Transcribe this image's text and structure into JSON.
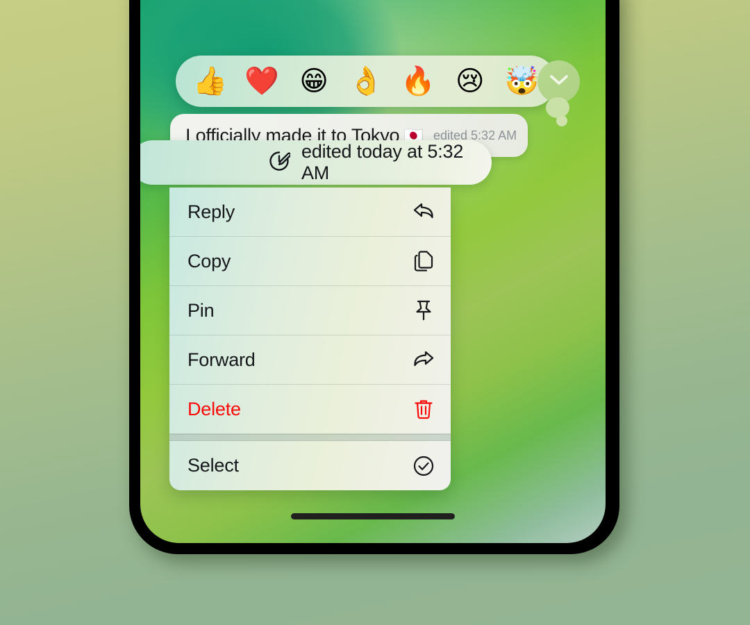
{
  "device": {
    "home_indicator": "home-indicator",
    "bezel_color": "#000000"
  },
  "wallpaper": {
    "gradient_from": "#0d9e6c",
    "gradient_mid": "#93c93d",
    "gradient_to": "#b3cdc2",
    "page_background_from": "#c6cd85",
    "page_background_to": "#94b593"
  },
  "reaction_bar": {
    "name": "emoji-reaction-bar",
    "emojis": [
      {
        "name": "thumbs-up-reaction",
        "glyph": "👍"
      },
      {
        "name": "heart-reaction",
        "glyph": "❤️"
      },
      {
        "name": "grinning-face-reaction",
        "glyph": "😁"
      },
      {
        "name": "ok-hand-reaction",
        "glyph": "👌"
      },
      {
        "name": "fire-reaction",
        "glyph": "🔥"
      },
      {
        "name": "crying-face-reaction",
        "glyph": "😢"
      },
      {
        "name": "exploding-head-reaction",
        "glyph": "🤯"
      }
    ],
    "more_button": {
      "name": "chevron-down-icon",
      "label": "⌄"
    }
  },
  "message": {
    "text": "I officially made it to Tokyo",
    "flag": "🇯🇵",
    "edited_inline": "edited 5:32 AM"
  },
  "edited_tooltip": {
    "icon": "clock-edit-icon",
    "text": "edited today at 5:32 AM"
  },
  "context_menu": {
    "items": [
      {
        "label": "Reply",
        "icon": "reply-arrow-icon",
        "destructive": false
      },
      {
        "label": "Copy",
        "icon": "copy-documents-icon",
        "destructive": false
      },
      {
        "label": "Pin",
        "icon": "pushpin-icon",
        "destructive": false
      },
      {
        "label": "Forward",
        "icon": "forward-arrow-icon",
        "destructive": false
      },
      {
        "label": "Delete",
        "icon": "trash-icon",
        "destructive": true
      },
      {
        "label": "Select",
        "icon": "check-circle-icon",
        "destructive": false
      }
    ],
    "destructive_color": "#fb0a0a",
    "label_color": "#15171a"
  }
}
